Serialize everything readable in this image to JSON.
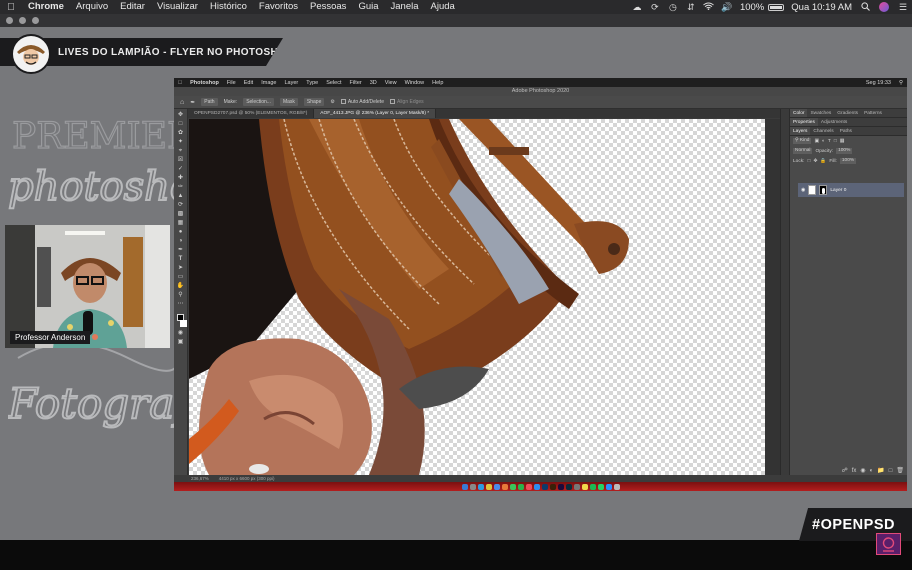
{
  "mac_menubar": {
    "apple": "",
    "items": [
      "Chrome",
      "Arquivo",
      "Editar",
      "Visualizar",
      "Histórico",
      "Favoritos",
      "Pessoas",
      "Guia",
      "Janela",
      "Ajuda"
    ],
    "battery": "100%",
    "clock": "Qua 10:19 AM",
    "icons": [
      "creative-cloud-icon",
      "sync-icon",
      "time-machine-icon",
      "transfer-icon",
      "wifi-icon",
      "volume-icon",
      "search-icon",
      "user-avatar-icon",
      "control-center-icon"
    ]
  },
  "stream": {
    "title": "LIVES DO LAMPIÃO - FLYER NO PHOTOSHOP",
    "presenter": "Professor Anderson",
    "brand": "#OPENPSD",
    "background_lettering": [
      "PREMIERE",
      "photoshop",
      "Fotografia"
    ]
  },
  "photoshop": {
    "inner_menubar": [
      "Photoshop",
      "File",
      "Edit",
      "Image",
      "Layer",
      "Type",
      "Select",
      "Filter",
      "3D",
      "View",
      "Window",
      "Help"
    ],
    "inner_clock": "Seg 19:33",
    "window_title": "Adobe Photoshop 2020",
    "options": {
      "mode": "Path",
      "make": "Make:",
      "selection": "Selection...",
      "mask": "Mask",
      "shape": "Shape",
      "auto_add": "Auto Add/Delete",
      "align": "Align Edges"
    },
    "tabs": [
      "OPENPSD2707.psd @ 50% (ELEMENTOS, RGB/8*)",
      "AOF_4413.JPG @ 236% (Layer 0, Layer Mask/8) *"
    ],
    "status": {
      "zoom": "236,67%",
      "doc": "4410 px x 6600 px (300 ppi)"
    },
    "panels": {
      "top_tabs": [
        "Color",
        "Swatches",
        "Gradients",
        "Patterns"
      ],
      "mid_tabs": [
        "Properties",
        "Adjustments"
      ],
      "layer_tabs": [
        "Layers",
        "Channels",
        "Paths"
      ],
      "kind": "Kind",
      "blend": "Normal",
      "opacity_label": "Opacity:",
      "opacity": "100%",
      "lock_label": "Lock:",
      "fill_label": "Fill:",
      "fill": "100%",
      "layer_name": "Layer 0"
    }
  },
  "colors": {
    "overlay_dark": "#1b1b1d",
    "leather": "#8a4a22",
    "skin": "#b07560",
    "dock_red": "#b31e1e"
  }
}
